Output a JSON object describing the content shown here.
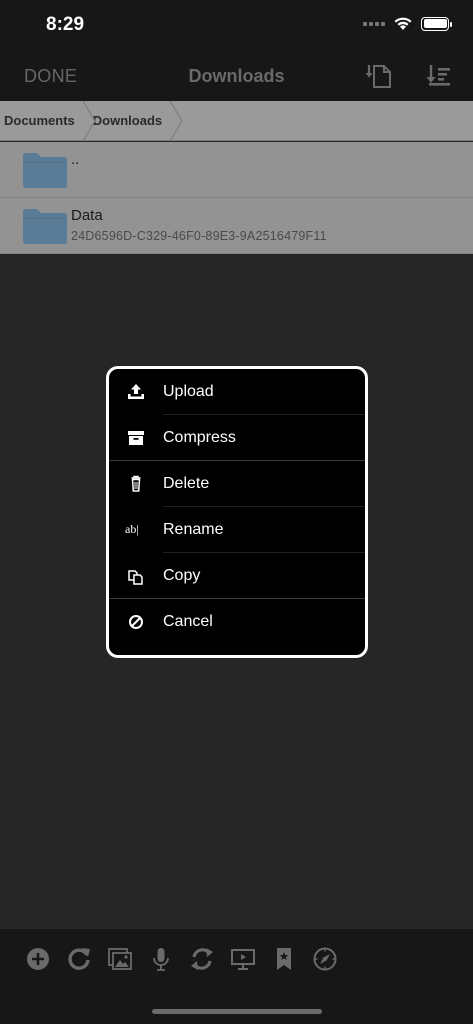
{
  "status_bar": {
    "time": "8:29"
  },
  "nav": {
    "done_label": "DONE",
    "title": "Downloads"
  },
  "breadcrumb": {
    "items": [
      "Documents",
      "Downloads"
    ]
  },
  "files": [
    {
      "name": "..",
      "subtitle": ""
    },
    {
      "name": "Data",
      "subtitle": "24D6596D-C329-46F0-89E3-9A2516479F11"
    }
  ],
  "action_sheet": {
    "items": [
      {
        "label": "Upload",
        "icon": "upload-icon"
      },
      {
        "label": "Compress",
        "icon": "archive-icon"
      },
      {
        "label": "Delete",
        "icon": "trash-icon"
      },
      {
        "label": "Rename",
        "icon": "rename-icon",
        "icon_text": "ab|"
      },
      {
        "label": "Copy",
        "icon": "copy-icon"
      },
      {
        "label": "Cancel",
        "icon": "cancel-icon"
      }
    ]
  },
  "toolbar": {
    "icons": [
      "add-icon",
      "refresh-icon",
      "photos-icon",
      "microphone-icon",
      "sync-icon",
      "screen-icon",
      "bookmark-icon",
      "compass-icon"
    ]
  },
  "colors": {
    "background": "#262626",
    "bar": "#171717",
    "breadcrumb": "#9a9a9a",
    "row": "#939393",
    "folder": "#5a7b96",
    "sheet": "#000000",
    "icon_dim": "#6a6a6a"
  }
}
